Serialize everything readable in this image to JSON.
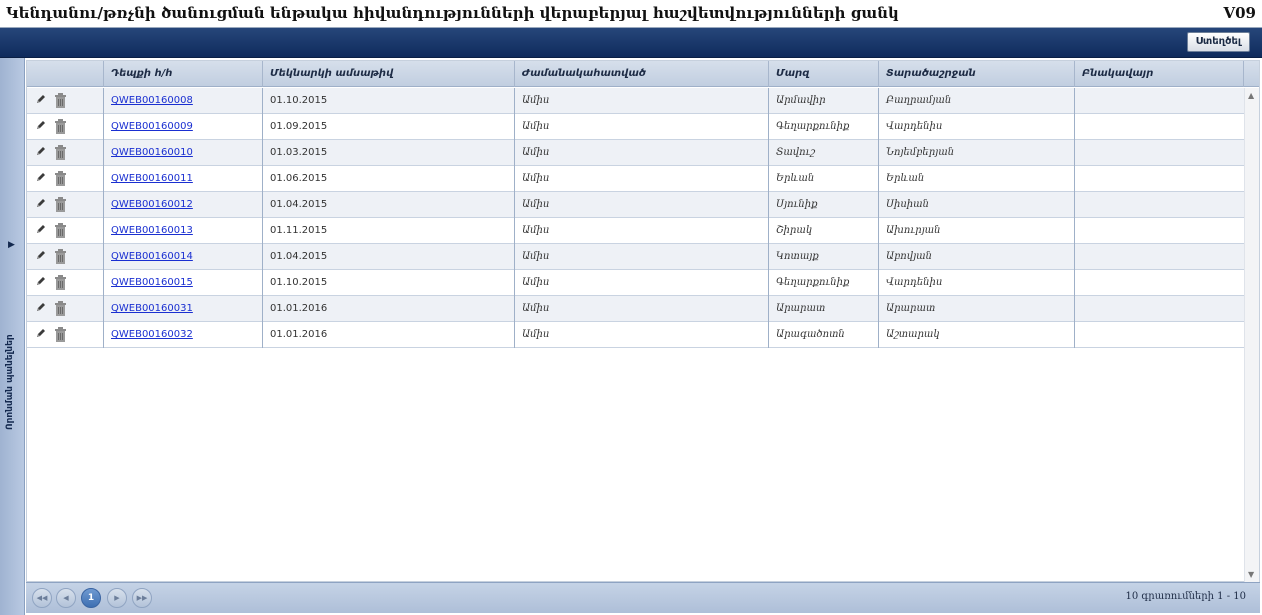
{
  "header": {
    "title": "Կենդանու/թռչնի ծանուցման ենթակա հիվանդությունների վերաբերյալ հաշվետվությունների ցանկ",
    "code": "V09"
  },
  "toolbar": {
    "create_label": "Ստեղծել"
  },
  "side_panel": {
    "label": "Որոնման պանելներ"
  },
  "table": {
    "columns": [
      "Դեպքի հ/հ",
      "Մեկնարկի ամսաթիվ",
      "Ժամանակահատված",
      "Մարզ",
      "Տարածաշրջան",
      "Բնակավայր"
    ],
    "rows": [
      {
        "id": "QWEB00160008",
        "date": "01.10.2015",
        "period": "Ամիս",
        "region": "Արմավիր",
        "district": "Բաղրամյան",
        "settlement": ""
      },
      {
        "id": "QWEB00160009",
        "date": "01.09.2015",
        "period": "Ամիս",
        "region": "Գեղարքունիք",
        "district": "Վարդենիս",
        "settlement": ""
      },
      {
        "id": "QWEB00160010",
        "date": "01.03.2015",
        "period": "Ամիս",
        "region": "Տավուշ",
        "district": "Նոյեմբերյան",
        "settlement": ""
      },
      {
        "id": "QWEB00160011",
        "date": "01.06.2015",
        "period": "Ամիս",
        "region": "Երևան",
        "district": "Երևան",
        "settlement": ""
      },
      {
        "id": "QWEB00160012",
        "date": "01.04.2015",
        "period": "Ամիս",
        "region": "Սյունիք",
        "district": "Սիսիան",
        "settlement": ""
      },
      {
        "id": "QWEB00160013",
        "date": "01.11.2015",
        "period": "Ամիս",
        "region": "Շիրակ",
        "district": "Ախուրյան",
        "settlement": ""
      },
      {
        "id": "QWEB00160014",
        "date": "01.04.2015",
        "period": "Ամիս",
        "region": "Կոտայք",
        "district": "Աբովյան",
        "settlement": ""
      },
      {
        "id": "QWEB00160015",
        "date": "01.10.2015",
        "period": "Ամիս",
        "region": "Գեղարքունիք",
        "district": "Վարդենիս",
        "settlement": ""
      },
      {
        "id": "QWEB00160031",
        "date": "01.01.2016",
        "period": "Ամիս",
        "region": "Արարատ",
        "district": "Արարատ",
        "settlement": ""
      },
      {
        "id": "QWEB00160032",
        "date": "01.01.2016",
        "period": "Ամիս",
        "region": "Արագածոտն",
        "district": "Աշտարակ",
        "settlement": ""
      }
    ]
  },
  "pager": {
    "current_page": "1",
    "info": "10 գրառումների 1 - 10"
  }
}
